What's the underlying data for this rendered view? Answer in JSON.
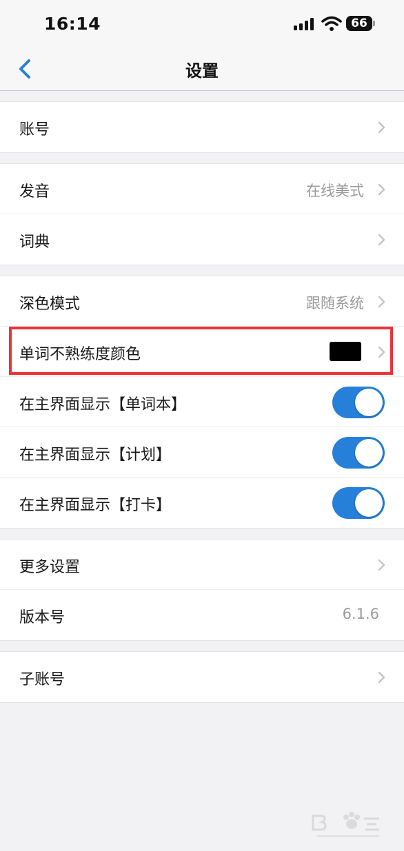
{
  "status_bar": {
    "time": "16:14",
    "battery": "66"
  },
  "nav": {
    "title": "设置"
  },
  "groups": {
    "account": {
      "label": "账号"
    },
    "pronunciation": {
      "label": "发音",
      "value": "在线美式"
    },
    "dictionary": {
      "label": "词典"
    },
    "dark_mode": {
      "label": "深色模式",
      "value": "跟随系统"
    },
    "unfamiliar_color": {
      "label": "单词不熟练度颜色",
      "swatch_color": "#000000"
    },
    "show_wordbook": {
      "label": "在主界面显示【单词本】",
      "on": true
    },
    "show_plan": {
      "label": "在主界面显示【计划】",
      "on": true
    },
    "show_checkin": {
      "label": "在主界面显示【打卡】",
      "on": true
    },
    "more_settings": {
      "label": "更多设置"
    },
    "version": {
      "label": "版本号",
      "value": "6.1.6"
    },
    "sub_account": {
      "label": "子账号"
    }
  },
  "colors": {
    "accent": "#2680d9",
    "highlight": "#e8343a"
  }
}
